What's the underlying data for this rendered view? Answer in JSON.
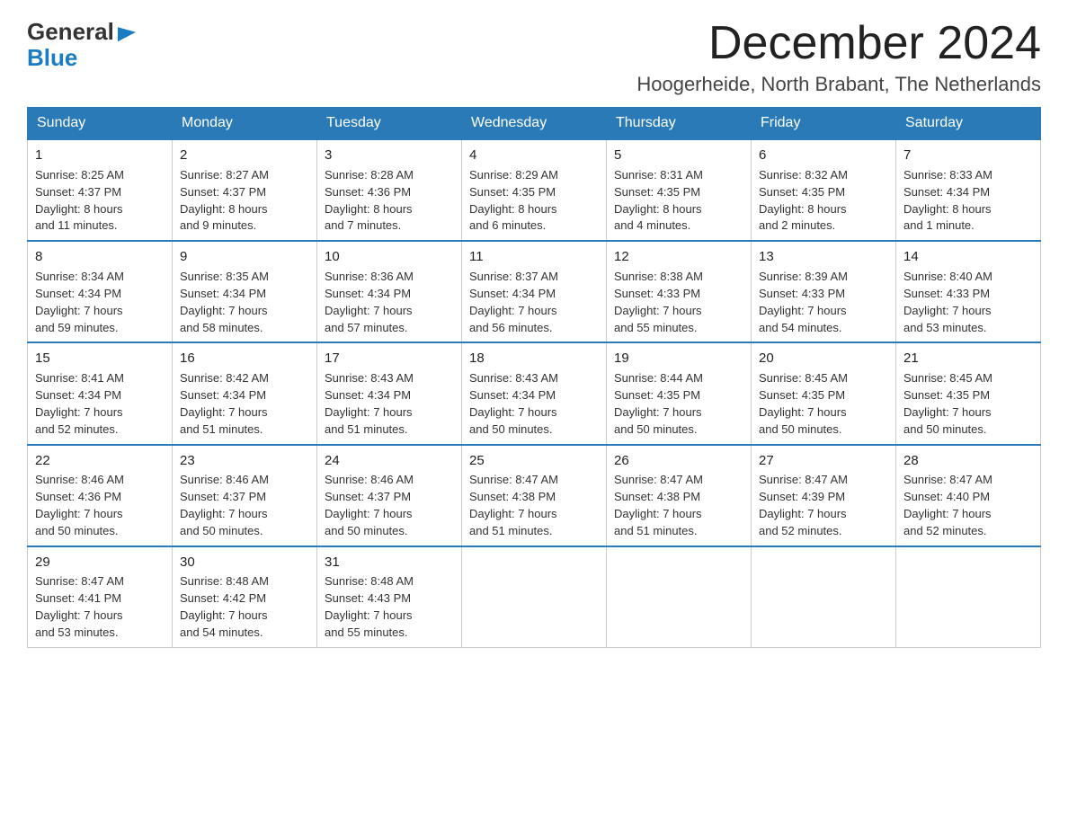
{
  "header": {
    "logo_general": "General",
    "logo_blue": "Blue",
    "month_year": "December 2024",
    "location": "Hoogerheide, North Brabant, The Netherlands"
  },
  "weekdays": [
    "Sunday",
    "Monday",
    "Tuesday",
    "Wednesday",
    "Thursday",
    "Friday",
    "Saturday"
  ],
  "weeks": [
    [
      {
        "day": "1",
        "info": "Sunrise: 8:25 AM\nSunset: 4:37 PM\nDaylight: 8 hours\nand 11 minutes."
      },
      {
        "day": "2",
        "info": "Sunrise: 8:27 AM\nSunset: 4:37 PM\nDaylight: 8 hours\nand 9 minutes."
      },
      {
        "day": "3",
        "info": "Sunrise: 8:28 AM\nSunset: 4:36 PM\nDaylight: 8 hours\nand 7 minutes."
      },
      {
        "day": "4",
        "info": "Sunrise: 8:29 AM\nSunset: 4:35 PM\nDaylight: 8 hours\nand 6 minutes."
      },
      {
        "day": "5",
        "info": "Sunrise: 8:31 AM\nSunset: 4:35 PM\nDaylight: 8 hours\nand 4 minutes."
      },
      {
        "day": "6",
        "info": "Sunrise: 8:32 AM\nSunset: 4:35 PM\nDaylight: 8 hours\nand 2 minutes."
      },
      {
        "day": "7",
        "info": "Sunrise: 8:33 AM\nSunset: 4:34 PM\nDaylight: 8 hours\nand 1 minute."
      }
    ],
    [
      {
        "day": "8",
        "info": "Sunrise: 8:34 AM\nSunset: 4:34 PM\nDaylight: 7 hours\nand 59 minutes."
      },
      {
        "day": "9",
        "info": "Sunrise: 8:35 AM\nSunset: 4:34 PM\nDaylight: 7 hours\nand 58 minutes."
      },
      {
        "day": "10",
        "info": "Sunrise: 8:36 AM\nSunset: 4:34 PM\nDaylight: 7 hours\nand 57 minutes."
      },
      {
        "day": "11",
        "info": "Sunrise: 8:37 AM\nSunset: 4:34 PM\nDaylight: 7 hours\nand 56 minutes."
      },
      {
        "day": "12",
        "info": "Sunrise: 8:38 AM\nSunset: 4:33 PM\nDaylight: 7 hours\nand 55 minutes."
      },
      {
        "day": "13",
        "info": "Sunrise: 8:39 AM\nSunset: 4:33 PM\nDaylight: 7 hours\nand 54 minutes."
      },
      {
        "day": "14",
        "info": "Sunrise: 8:40 AM\nSunset: 4:33 PM\nDaylight: 7 hours\nand 53 minutes."
      }
    ],
    [
      {
        "day": "15",
        "info": "Sunrise: 8:41 AM\nSunset: 4:34 PM\nDaylight: 7 hours\nand 52 minutes."
      },
      {
        "day": "16",
        "info": "Sunrise: 8:42 AM\nSunset: 4:34 PM\nDaylight: 7 hours\nand 51 minutes."
      },
      {
        "day": "17",
        "info": "Sunrise: 8:43 AM\nSunset: 4:34 PM\nDaylight: 7 hours\nand 51 minutes."
      },
      {
        "day": "18",
        "info": "Sunrise: 8:43 AM\nSunset: 4:34 PM\nDaylight: 7 hours\nand 50 minutes."
      },
      {
        "day": "19",
        "info": "Sunrise: 8:44 AM\nSunset: 4:35 PM\nDaylight: 7 hours\nand 50 minutes."
      },
      {
        "day": "20",
        "info": "Sunrise: 8:45 AM\nSunset: 4:35 PM\nDaylight: 7 hours\nand 50 minutes."
      },
      {
        "day": "21",
        "info": "Sunrise: 8:45 AM\nSunset: 4:35 PM\nDaylight: 7 hours\nand 50 minutes."
      }
    ],
    [
      {
        "day": "22",
        "info": "Sunrise: 8:46 AM\nSunset: 4:36 PM\nDaylight: 7 hours\nand 50 minutes."
      },
      {
        "day": "23",
        "info": "Sunrise: 8:46 AM\nSunset: 4:37 PM\nDaylight: 7 hours\nand 50 minutes."
      },
      {
        "day": "24",
        "info": "Sunrise: 8:46 AM\nSunset: 4:37 PM\nDaylight: 7 hours\nand 50 minutes."
      },
      {
        "day": "25",
        "info": "Sunrise: 8:47 AM\nSunset: 4:38 PM\nDaylight: 7 hours\nand 51 minutes."
      },
      {
        "day": "26",
        "info": "Sunrise: 8:47 AM\nSunset: 4:38 PM\nDaylight: 7 hours\nand 51 minutes."
      },
      {
        "day": "27",
        "info": "Sunrise: 8:47 AM\nSunset: 4:39 PM\nDaylight: 7 hours\nand 52 minutes."
      },
      {
        "day": "28",
        "info": "Sunrise: 8:47 AM\nSunset: 4:40 PM\nDaylight: 7 hours\nand 52 minutes."
      }
    ],
    [
      {
        "day": "29",
        "info": "Sunrise: 8:47 AM\nSunset: 4:41 PM\nDaylight: 7 hours\nand 53 minutes."
      },
      {
        "day": "30",
        "info": "Sunrise: 8:48 AM\nSunset: 4:42 PM\nDaylight: 7 hours\nand 54 minutes."
      },
      {
        "day": "31",
        "info": "Sunrise: 8:48 AM\nSunset: 4:43 PM\nDaylight: 7 hours\nand 55 minutes."
      },
      {
        "day": "",
        "info": ""
      },
      {
        "day": "",
        "info": ""
      },
      {
        "day": "",
        "info": ""
      },
      {
        "day": "",
        "info": ""
      }
    ]
  ]
}
